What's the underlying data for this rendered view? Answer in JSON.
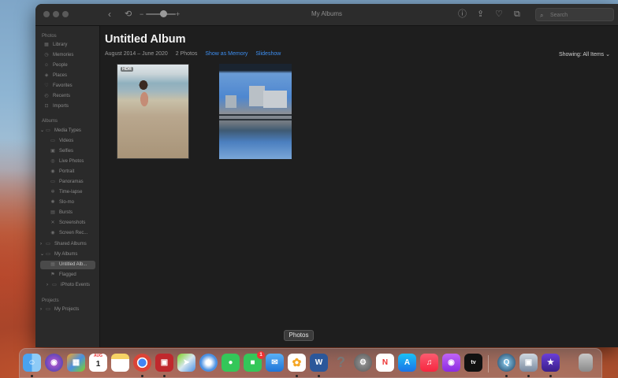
{
  "window": {
    "title": "My Albums",
    "search_placeholder": "Search"
  },
  "sidebar": {
    "section_photos": "Photos",
    "photos_items": [
      {
        "label": "Library",
        "icon": "library-icon"
      },
      {
        "label": "Memories",
        "icon": "memories-icon"
      },
      {
        "label": "People",
        "icon": "people-icon"
      },
      {
        "label": "Places",
        "icon": "places-icon"
      },
      {
        "label": "Favorites",
        "icon": "heart-icon"
      },
      {
        "label": "Recents",
        "icon": "clock-icon"
      },
      {
        "label": "Imports",
        "icon": "import-icon"
      }
    ],
    "section_albums": "Albums",
    "media_types_label": "Media Types",
    "media_items": [
      {
        "label": "Videos"
      },
      {
        "label": "Selfies"
      },
      {
        "label": "Live Photos"
      },
      {
        "label": "Portrait"
      },
      {
        "label": "Panoramas"
      },
      {
        "label": "Time-lapse"
      },
      {
        "label": "Slo-mo"
      },
      {
        "label": "Bursts"
      },
      {
        "label": "Screenshots"
      },
      {
        "label": "Screen Rec..."
      }
    ],
    "shared_albums_label": "Shared Albums",
    "my_albums_label": "My Albums",
    "my_albums_items": [
      {
        "label": "Untitled Alb..."
      },
      {
        "label": "Flagged"
      },
      {
        "label": "iPhoto Events"
      }
    ],
    "section_projects": "Projects",
    "my_projects_label": "My Projects"
  },
  "main": {
    "album_title": "Untitled Album",
    "date_range": "August 2014 – June 2020",
    "photo_count": "2 Photos",
    "show_as_memory": "Show as Memory",
    "slideshow": "Slideshow",
    "showing": "Showing: All Items",
    "photos": [
      {
        "badge": "HDR"
      },
      {
        "badge": ""
      }
    ]
  },
  "dock": {
    "tooltip": "Photos",
    "calendar_month": "AUG",
    "calendar_day": "1",
    "facetime_badge": "1",
    "apps": [
      "Finder",
      "Siri",
      "Launchpad",
      "Calendar",
      "Notes",
      "Chrome",
      "Photo Booth",
      "Maps",
      "Safari",
      "Messages",
      "FaceTime",
      "Mail",
      "Photos",
      "Word",
      "Help",
      "System Preferences",
      "News",
      "App Store",
      "Music",
      "Podcasts",
      "TV",
      "QuickTime Player",
      "Preview",
      "iMovie",
      "Trash"
    ]
  },
  "colors": {
    "accent_link": "#3d8ef0",
    "window_bg": "#1e1e1e",
    "sidebar_bg": "#2a2a2a"
  }
}
